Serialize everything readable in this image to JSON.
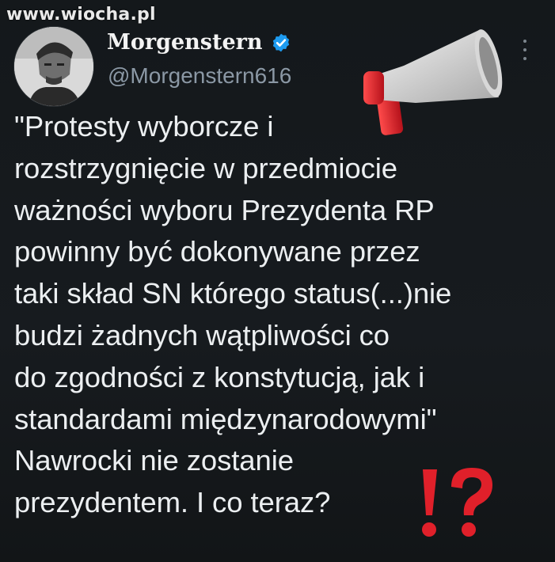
{
  "watermark": {
    "text": "www.wiocha.pl"
  },
  "tweet": {
    "author": {
      "display_name": "Morgenstern",
      "handle": "@Morgenstern616",
      "verified": true,
      "avatar_icon": "profile-photo"
    },
    "lines": [
      "\"Protesty wyborcze i",
      "rozstrzygnięcie w przedmiocie",
      "ważności wyboru Prezydenta RP",
      "powinny być dokonywane przez",
      "taki skład SN którego status(...)nie",
      "budzi żadnych wątpliwości co",
      "do zgodności z konstytucją, jak i",
      "standardami międzynarodowymi\"",
      "Nawrocki nie zostanie",
      "prezydentem. I co teraz?"
    ]
  },
  "icons": {
    "more": "more-options-icon",
    "megaphone": "megaphone-emoji",
    "interrobang": "exclamation-question-emoji",
    "verified": "verified-badge-icon"
  },
  "colors": {
    "background": "#15191c",
    "text": "#eceff1",
    "handle": "#8b98a5",
    "verified": "#1d9bf0",
    "emoji_red": "#e0202a"
  }
}
